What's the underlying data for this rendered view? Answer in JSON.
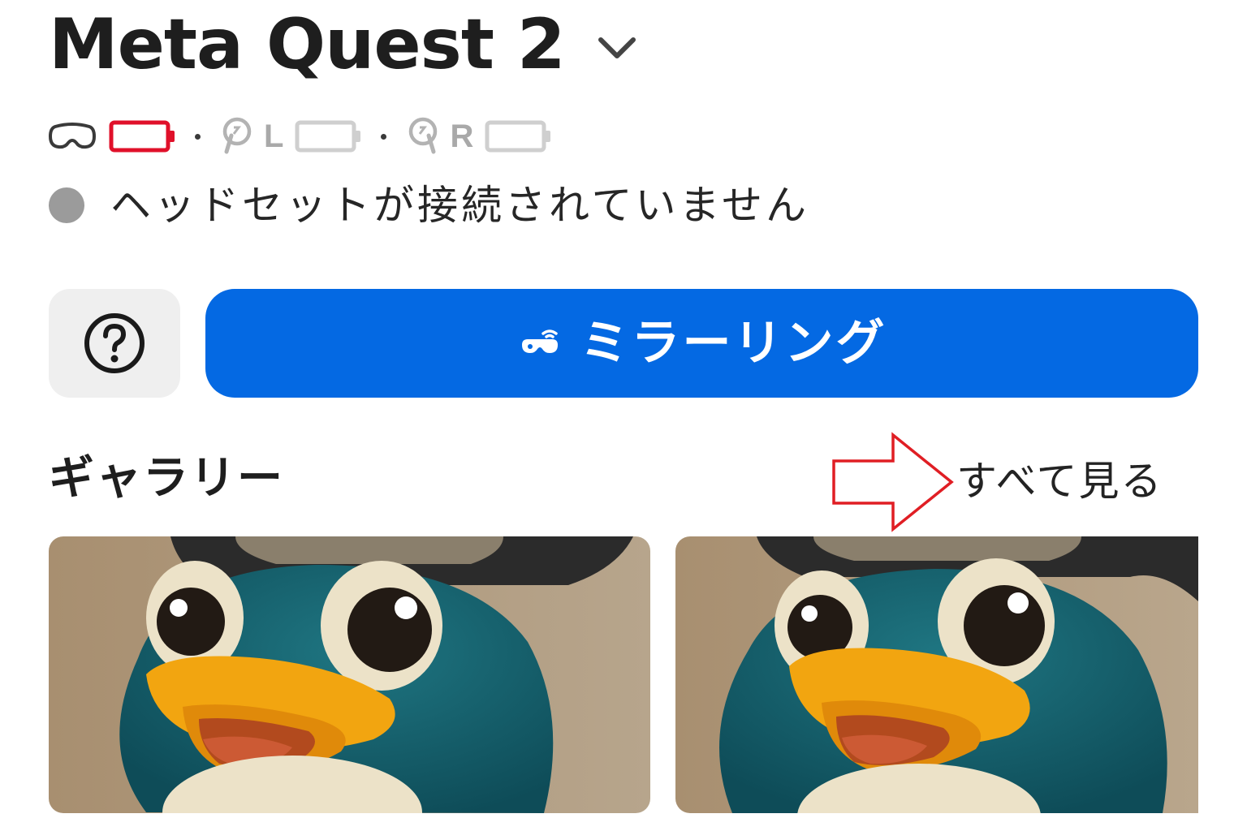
{
  "header": {
    "device_name": "Meta Quest 2",
    "dropdown_icon": "chevron-down-icon"
  },
  "battery": {
    "headset": {
      "icon": "headset-icon",
      "level": 0,
      "color": "#e0102a"
    },
    "left_controller": {
      "label": "L",
      "icon": "left-controller-icon",
      "level": 0,
      "color": "#cfcfcf"
    },
    "right_controller": {
      "label": "R",
      "icon": "right-controller-icon",
      "level": 0,
      "color": "#cfcfcf"
    }
  },
  "connection": {
    "status_text": "ヘッドセットが接続されていません",
    "dot_color": "#9b9b9b"
  },
  "actions": {
    "help_icon": "question-circle-icon",
    "mirroring_label": "ミラーリング",
    "mirroring_icon": "cast-icon",
    "accent_color": "#0469e3"
  },
  "gallery": {
    "title": "ギャラリー",
    "see_all_label": "すべて見る",
    "annotation": "red-arrow-outline",
    "thumbnails": [
      {
        "subject": "penguin-character-thumbnail"
      },
      {
        "subject": "penguin-character-thumbnail"
      }
    ]
  }
}
